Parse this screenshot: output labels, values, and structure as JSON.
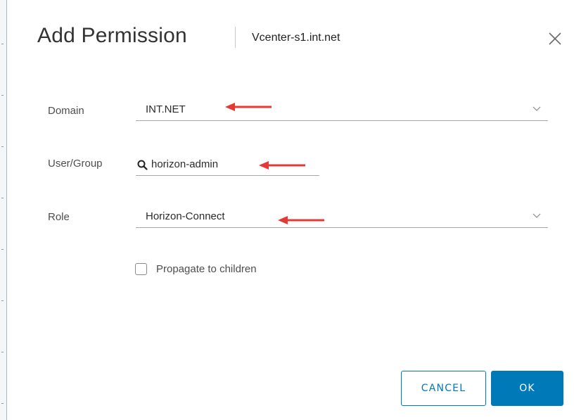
{
  "dialog": {
    "title": "Add Permission",
    "subtitle": "Vcenter-s1.int.net",
    "close_icon": "close-icon"
  },
  "form": {
    "domain": {
      "label": "Domain",
      "value": "INT.NET"
    },
    "user_group": {
      "label": "User/Group",
      "value": "horizon-admin",
      "icon": "search-icon"
    },
    "role": {
      "label": "Role",
      "value": "Horizon-Connect"
    },
    "propagate": {
      "label": "Propagate to children",
      "checked": false
    }
  },
  "buttons": {
    "cancel": "CANCEL",
    "ok": "OK"
  },
  "colors": {
    "accent": "#0079b8",
    "annotation_arrow": "#e53935"
  }
}
